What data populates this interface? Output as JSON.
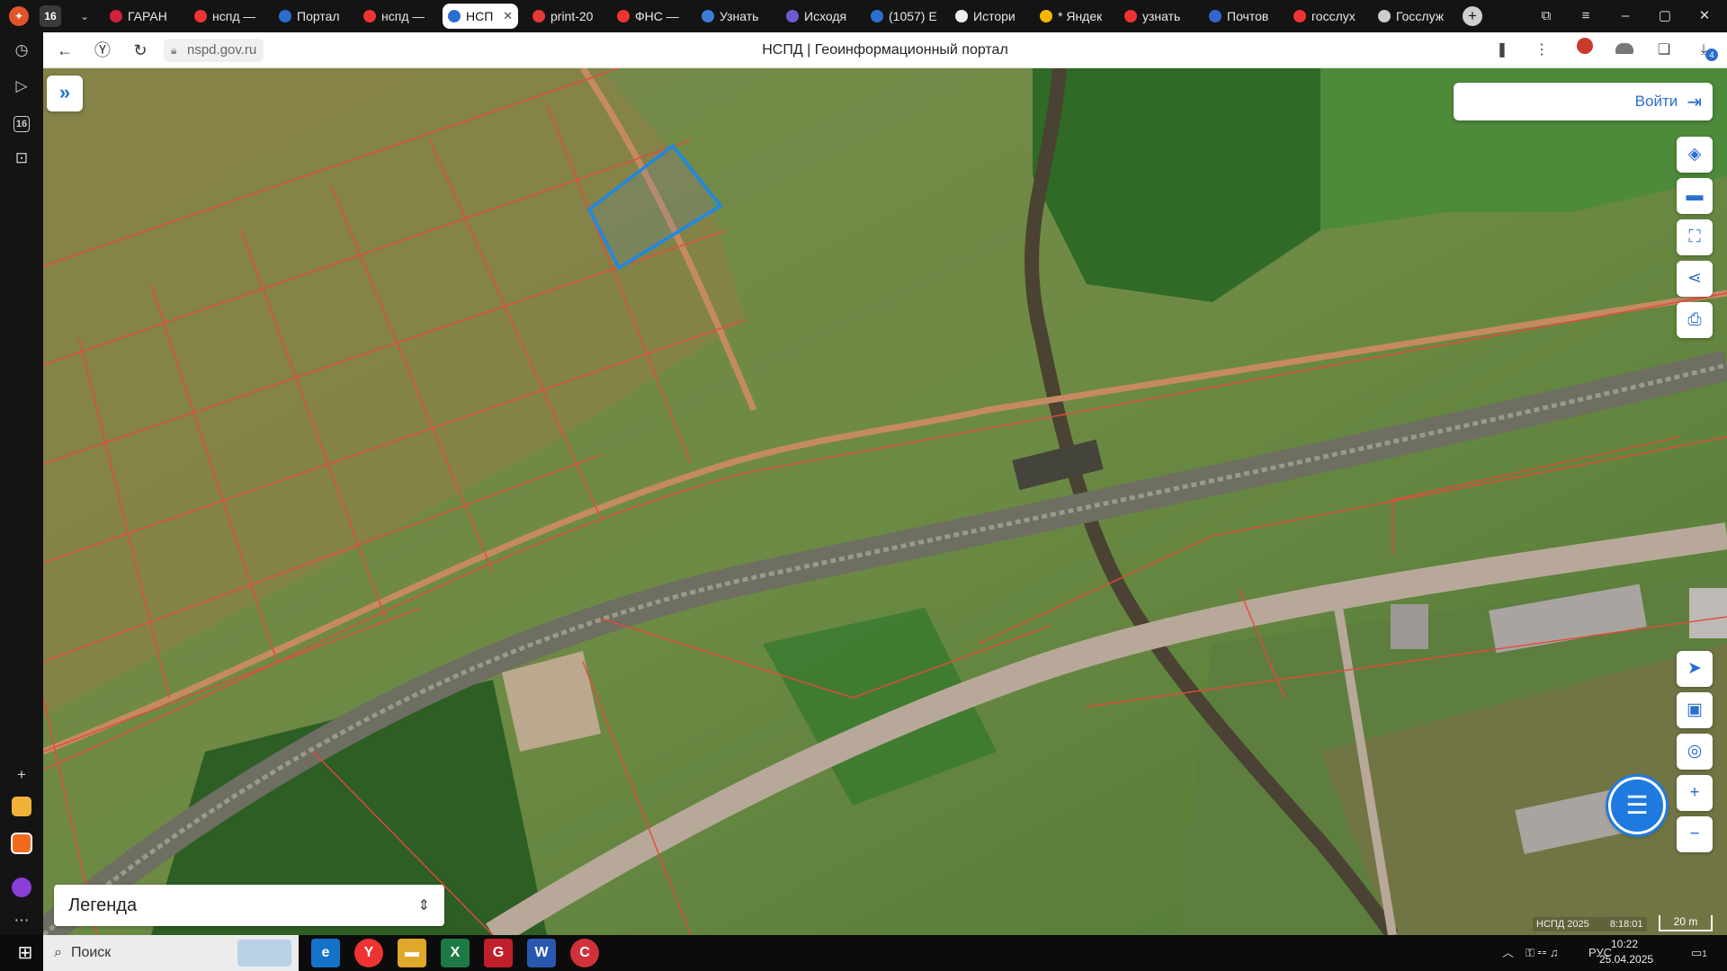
{
  "tabs": [
    {
      "label": "ГАРАН",
      "icon": "garant-icon",
      "color": "#d4203b"
    },
    {
      "label": "нспд —",
      "icon": "yandex-icon",
      "color": "#ee3333"
    },
    {
      "label": "Портал",
      "icon": "portal-icon",
      "color": "#2a6fd0"
    },
    {
      "label": "нспд —",
      "icon": "yandex-icon",
      "color": "#ee3333"
    },
    {
      "label": "НСП,",
      "icon": "nspd-icon",
      "color": "#2a6fd0",
      "active": true
    },
    {
      "label": "print-20",
      "icon": "pdf-icon",
      "color": "#e53935"
    },
    {
      "label": "ФНС —",
      "icon": "yandex-icon",
      "color": "#ee3333"
    },
    {
      "label": "Узнать",
      "icon": "gosuslugi-icon",
      "color": "#3d7bd8"
    },
    {
      "label": "Исходя",
      "icon": "mail-icon",
      "color": "#6b5bd2"
    },
    {
      "label": "(1057) E",
      "icon": "mail-box-icon",
      "color": "#2a6fd0"
    },
    {
      "label": "Истори",
      "icon": "history-icon",
      "color": "#eeeeee"
    },
    {
      "label": "* Яндек",
      "icon": "yandex-mail-icon",
      "color": "#f5b700"
    },
    {
      "label": "узнать",
      "icon": "yandex-icon",
      "color": "#ee3333"
    },
    {
      "label": "Почтов",
      "icon": "post-icon",
      "color": "#3366cc"
    },
    {
      "label": "госслух",
      "icon": "yandex-icon",
      "color": "#ee3333"
    },
    {
      "label": "Госслуж",
      "icon": "gov-icon",
      "color": "#cccccc"
    }
  ],
  "tab_count": "16",
  "sidebar_badge": "16",
  "url": "nspd.gov.ru",
  "page_title": "НСПД | Геоинформационный портал",
  "downloads_badge": "4",
  "map": {
    "login_label": "Войти",
    "legend_label": "Легенда",
    "credit": "НСПД 2025",
    "scale_label": "20 m",
    "coords": "8:18:01"
  },
  "taskbar": {
    "search_placeholder": "Поиск",
    "lang": "РУС",
    "time": "10:22",
    "date": "25.04.2025",
    "notif_count": "1"
  }
}
